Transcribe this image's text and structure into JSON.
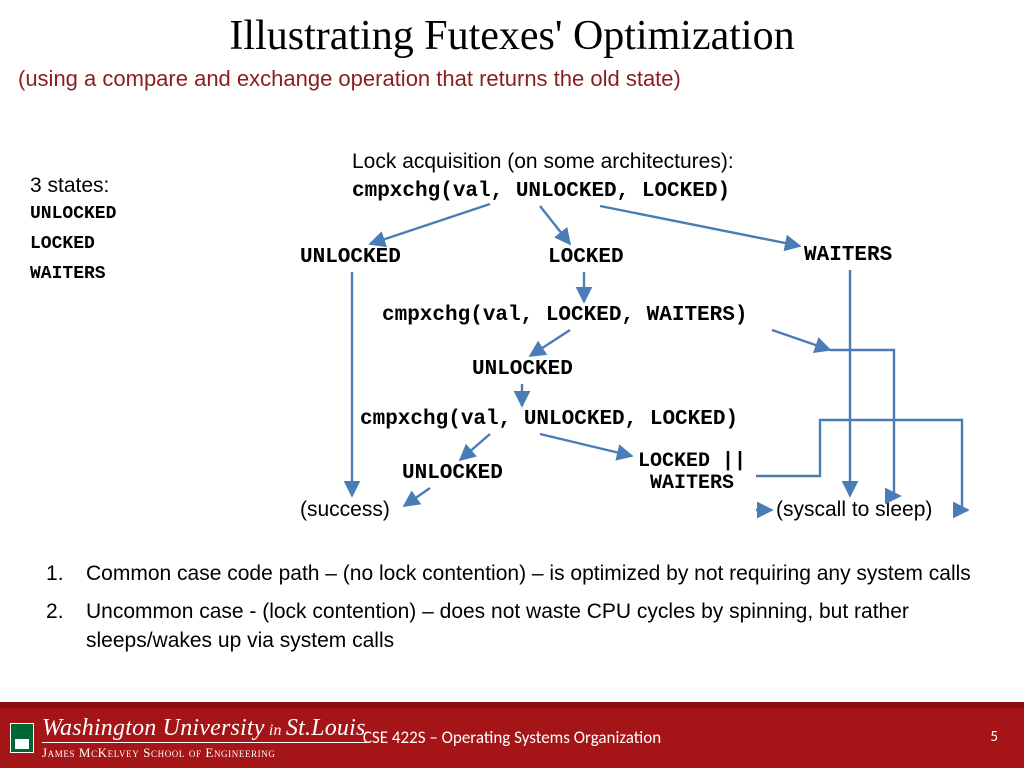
{
  "title": "Illustrating Futexes' Optimization",
  "subtitle": "(using a compare and exchange operation that returns the old state)",
  "states": {
    "heading": "3 states:",
    "s1": "UNLOCKED",
    "s2": "LOCKED",
    "s3": "WAITERS"
  },
  "acq_heading": "Lock acquisition (on some architectures):",
  "code1": "cmpxchg(val, UNLOCKED, LOCKED)",
  "branch_unlocked": "UNLOCKED",
  "branch_locked": "LOCKED",
  "branch_waiters": "WAITERS",
  "code2": "cmpxchg(val, LOCKED, WAITERS)",
  "branch2_unlocked": "UNLOCKED",
  "code3": "cmpxchg(val, UNLOCKED, LOCKED)",
  "branch3_unlocked": "UNLOCKED",
  "branch3_lockedwaiters_a": "LOCKED ||",
  "branch3_lockedwaiters_b": "WAITERS",
  "success": "(success)",
  "syscall": "(syscall to sleep)",
  "bullet1": "Common case code path – (no lock contention) – is optimized by not requiring any system calls",
  "bullet2": "Uncommon case - (lock contention) – does not waste CPU cycles by spinning, but rather sleeps/wakes up via system calls",
  "footer": {
    "uni_top_a": "Washington University",
    "uni_in": " in ",
    "uni_top_b": "St.Louis",
    "uni_bot": "James McKelvey School of Engineering",
    "course": "CSE 422S – Operating Systems Organization",
    "page": "5"
  }
}
